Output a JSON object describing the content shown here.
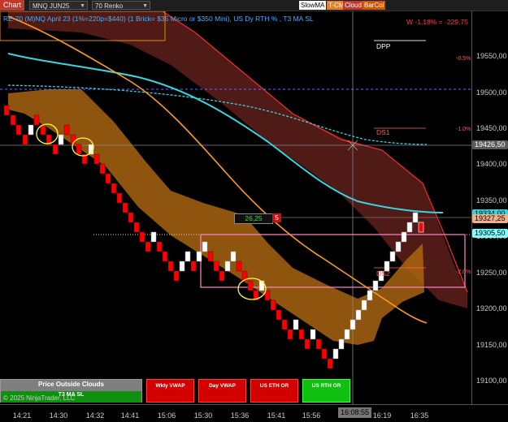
{
  "toolbar": {
    "chart_tab": "Chart",
    "instrument": "MNQ JUN25",
    "period": "70 Renko",
    "btn_slowma": "SlowMA",
    "btn_tcm": "T-CM",
    "btn_cloud": "Cloud",
    "btn_barcol": "BarCol"
  },
  "chart": {
    "title": "RE-70 (M)NQ April 23 (1%=220p=$440) (1 Brick= $35 Micro or $350 Mini), US Dy RTH % , T3 MA SL",
    "pnl": "W -1,18% = -229,75",
    "dpp": "DPP",
    "ds1": "DS1",
    "ds2": "DS2",
    "pct_labels": [
      "-0.5%",
      "-1.0%",
      "-2.0%"
    ],
    "box_left": "26,25",
    "box_right": "5",
    "copyright": "© 2025 NinjaTrader, LLC"
  },
  "price_axis": {
    "labels": [
      "19550,00",
      "19500,00",
      "19450,00",
      "19400,00",
      "19350,00",
      "19300,00",
      "19250,00",
      "19200,00",
      "19150,00",
      "19100,00"
    ],
    "tag_last": "19426,50",
    "tag_high": "19334,00",
    "tag_mid": "19327,25",
    "tag_cur": "19305,50"
  },
  "time_axis": {
    "labels": [
      "14:21",
      "14:30",
      "14:32",
      "14:41",
      "15:06",
      "15:30",
      "15:36",
      "15:41",
      "15:56",
      "16:08:55",
      "16:19",
      "16:35"
    ],
    "cursor": "16:08:55"
  },
  "bottom_panel": {
    "outside_title": "Price Outside Clouds",
    "outside_sub": "T3 MA SL",
    "buttons": [
      "Wkly VWAP",
      "Day VWAP",
      "US ETH OR",
      "US RTH OR"
    ]
  },
  "colors": {
    "bull": "#ffffff",
    "bear": "#ff0000",
    "cloud_orange": "#d98c1a",
    "cloud_red": "#7a2a22",
    "cyan": "#3ad6e0",
    "t3": "#ff9a1f",
    "green_btn": "#10c010",
    "red_btn": "#e00000"
  },
  "chart_data": {
    "type": "renko",
    "price_unit": "points",
    "y_range": [
      19090,
      19590
    ],
    "bricks_close": [
      19355,
      19340,
      19320,
      19305,
      19320,
      19300,
      19290,
      19270,
      19255,
      19240,
      19225,
      19210,
      19195,
      19180,
      19165,
      19150,
      19135,
      19120,
      19105,
      19125,
      19110,
      19140,
      19160,
      19180,
      19200,
      19220,
      19240,
      19260,
      19280,
      19300,
      19320,
      19334
    ],
    "series": [
      {
        "name": "Wkly VWAP",
        "y_start": 19460,
        "y_end": 19430
      },
      {
        "name": "Day VWAP",
        "y_start": 19540,
        "y_end": 19350
      }
    ]
  }
}
